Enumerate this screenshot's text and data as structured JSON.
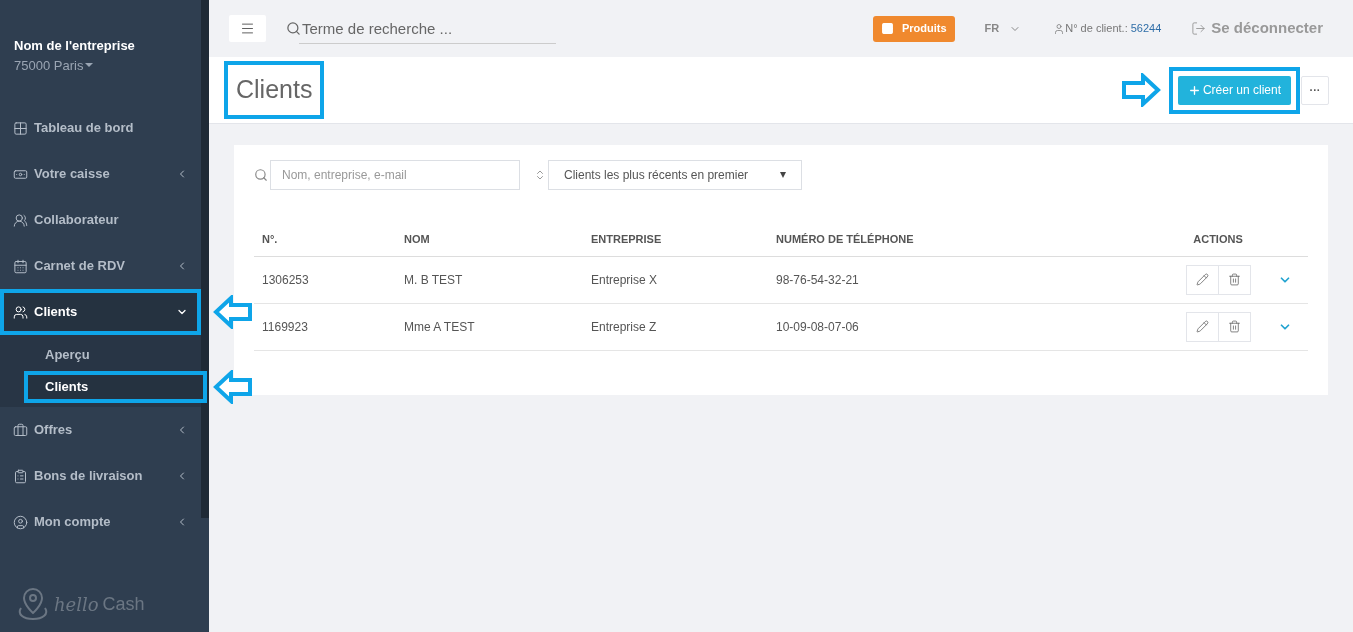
{
  "sidebar": {
    "company": "Nom de l'entreprise",
    "city": "75000 Paris",
    "items": [
      {
        "label": "Tableau de bord",
        "has_submenu": false,
        "expanded": false,
        "selected": false,
        "highlighted": false
      },
      {
        "label": "Votre caisse",
        "has_submenu": true,
        "expanded": false,
        "selected": false,
        "highlighted": false
      },
      {
        "label": "Collaborateur",
        "has_submenu": false,
        "expanded": false,
        "selected": false,
        "highlighted": false
      },
      {
        "label": "Carnet de RDV",
        "has_submenu": true,
        "expanded": false,
        "selected": false,
        "highlighted": false
      },
      {
        "label": "Clients",
        "has_submenu": true,
        "expanded": true,
        "selected": true,
        "highlighted": true,
        "children": [
          {
            "label": "Aperçu",
            "selected": false,
            "highlighted": false
          },
          {
            "label": "Clients",
            "selected": true,
            "highlighted": true
          }
        ]
      },
      {
        "label": "Offres",
        "has_submenu": true,
        "expanded": false,
        "selected": false,
        "highlighted": false
      },
      {
        "label": "Bons de livraison",
        "has_submenu": true,
        "expanded": false,
        "selected": false,
        "highlighted": false
      },
      {
        "label": "Mon compte",
        "has_submenu": true,
        "expanded": false,
        "selected": false,
        "highlighted": false
      }
    ],
    "logo": {
      "word1": "hello",
      "word2": "Cash"
    }
  },
  "topbar": {
    "search": {
      "placeholder": "Terme de recherche ..."
    },
    "products_button": "Produits",
    "language": "FR",
    "customer_label": "N° de client.:",
    "customer_number": "56244",
    "logout": "Se déconnecter"
  },
  "page": {
    "title": "Clients",
    "title_highlighted": true,
    "create_button": "Créer un client",
    "create_highlighted": true,
    "more_button": "···"
  },
  "filters": {
    "search": {
      "placeholder": "Nom, entreprise, e-mail"
    },
    "sort": "Clients les plus récents en premier"
  },
  "table": {
    "columns": [
      "N°.",
      "NOM",
      "ENTREPRISE",
      "NUMÉRO DE TÉLÉPHONE",
      "ACTIONS"
    ],
    "rows": [
      [
        "1306253",
        "M. B TEST",
        "Entreprise X",
        "98-76-54-32-21"
      ],
      [
        "1169923",
        "Mme A TEST",
        "Entreprise Z",
        "10-09-08-07-06"
      ]
    ]
  }
}
